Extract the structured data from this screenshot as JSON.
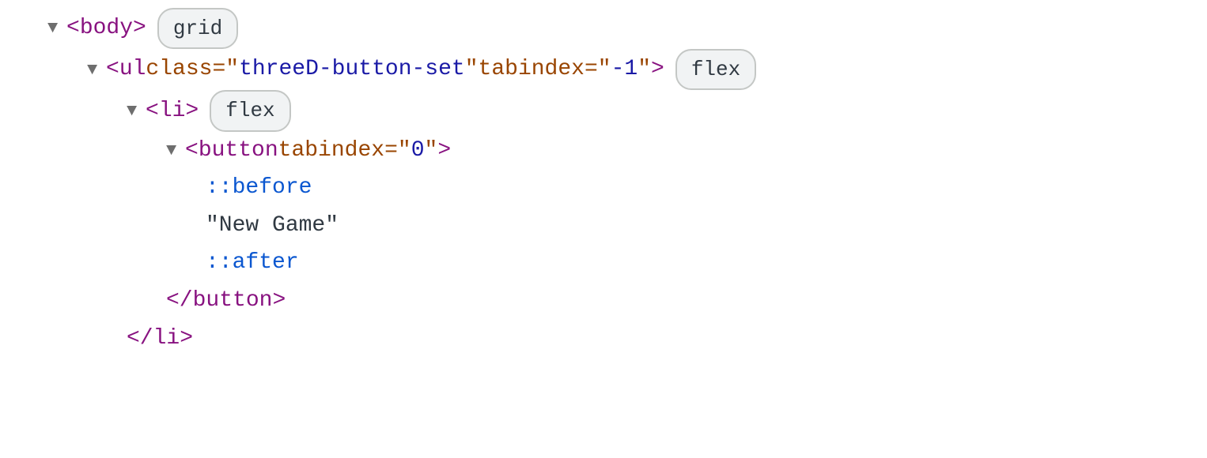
{
  "rows": [
    {
      "indent": 0,
      "arrow": "▼",
      "open_bracket": "<",
      "tag": "body",
      "attrs": [],
      "close_bracket": ">",
      "badge": "grid"
    },
    {
      "indent": 1,
      "arrow": "▼",
      "open_bracket": "<",
      "tag": "ul",
      "attrs": [
        {
          "name": "class",
          "value": "threeD-button-set"
        },
        {
          "name": "tabindex",
          "value": "-1"
        }
      ],
      "close_bracket": ">",
      "badge": "flex"
    },
    {
      "indent": 2,
      "arrow": "▼",
      "open_bracket": "<",
      "tag": "li",
      "attrs": [],
      "close_bracket": ">",
      "badge": "flex"
    },
    {
      "indent": 3,
      "arrow": "▼",
      "open_bracket": "<",
      "tag": "button",
      "attrs": [
        {
          "name": "tabindex",
          "value": "0"
        }
      ],
      "close_bracket": ">",
      "badge": null
    },
    {
      "indent": 4,
      "pseudo": "::before"
    },
    {
      "indent": 4,
      "text": "\"New Game\""
    },
    {
      "indent": 4,
      "pseudo": "::after"
    },
    {
      "indent": 3,
      "closing_tag": "button"
    },
    {
      "indent": 2,
      "closing_tag": "li"
    }
  ]
}
